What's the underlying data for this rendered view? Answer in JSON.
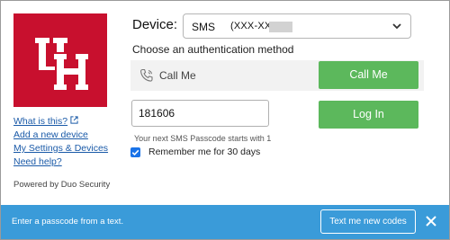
{
  "brand": {
    "accent": "#c8102e",
    "logo_text": "UH"
  },
  "sidebar": {
    "links": [
      {
        "label": "What is this?"
      },
      {
        "label": "Add a new device"
      },
      {
        "label": "My Settings & Devices"
      },
      {
        "label": "Need help?"
      }
    ],
    "powered_by": "Powered by Duo Security"
  },
  "device": {
    "label": "Device:",
    "selected_type": "SMS",
    "selected_number": "(XXX-XXX-"
  },
  "auth": {
    "heading": "Choose an authentication method",
    "call_label": "Call Me",
    "call_button": "Call Me",
    "passcode_value": "181606",
    "login_button": "Log In",
    "hint": "Your next SMS Passcode starts with 1",
    "remember_label": "Remember me for 30 days",
    "remember_checked": true
  },
  "banner": {
    "message": "Enter a passcode from a text.",
    "text_button": "Text me new codes",
    "background": "#3a9bd9"
  },
  "colors": {
    "green_button": "#5cb85c",
    "link": "#1a5aa8"
  },
  "icons": [
    "phone-icon",
    "external-link-icon",
    "chevron-down-icon",
    "check-icon",
    "close-icon"
  ]
}
